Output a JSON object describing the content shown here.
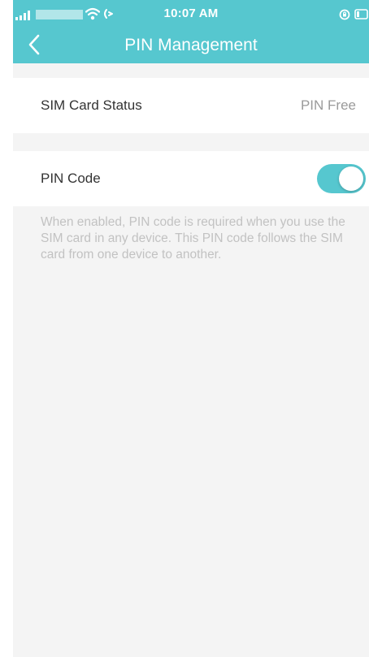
{
  "status_bar": {
    "time": "10:07 AM",
    "signal_icon": "cellular-signal-icon",
    "wifi_icon": "wifi-icon",
    "activity_icon": "sync-activity-icon",
    "orientation_icon": "orientation-lock-icon",
    "battery_icon": "battery-icon"
  },
  "nav": {
    "title": "PIN Management",
    "back_icon": "chevron-left-icon"
  },
  "sim_status": {
    "label": "SIM Card Status",
    "value": "PIN Free"
  },
  "pin_code": {
    "label": "PIN Code",
    "enabled": true
  },
  "help_text": "When enabled, PIN code is required when you use the SIM card in any device. This PIN code follows the SIM card from one device to another.",
  "colors": {
    "accent": "#56c7cf",
    "background": "#f4f4f4",
    "row_background": "#ffffff",
    "label_text": "#333333",
    "value_text": "#9a9a9a",
    "help_text": "#c2c2c2"
  }
}
